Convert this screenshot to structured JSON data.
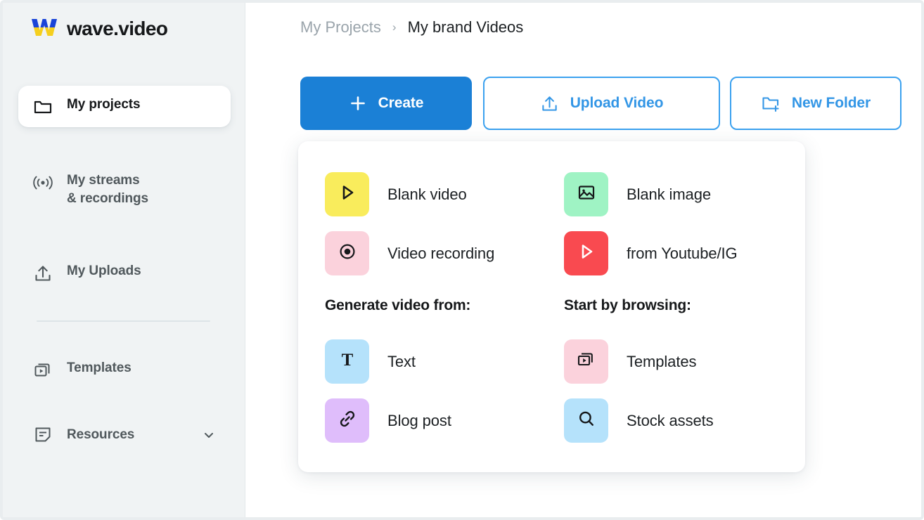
{
  "brand": {
    "name": "wave.video",
    "logo_icon": "wave-w-logo-icon",
    "logo_colors": {
      "top": "#1a44d8",
      "bottom": "#f5cf1e"
    }
  },
  "sidebar": {
    "background": "#f0f3f4",
    "items": [
      {
        "id": "my-projects",
        "label": "My projects",
        "icon": "folder-icon",
        "active": true
      },
      {
        "id": "my-streams",
        "label": "My streams\n& recordings",
        "label_line1": "My streams",
        "label_line2": "& recordings",
        "icon": "broadcast-icon",
        "active": false
      },
      {
        "id": "my-uploads",
        "label": "My Uploads",
        "icon": "upload-icon",
        "active": false
      },
      {
        "id": "templates",
        "label": "Templates",
        "icon": "templates-icon",
        "active": false
      },
      {
        "id": "resources",
        "label": "Resources",
        "icon": "note-icon",
        "chevron": "chevron-down-icon",
        "active": false
      }
    ]
  },
  "breadcrumb": {
    "root": "My Projects",
    "separator": "›",
    "current": "My brand Videos"
  },
  "toolbar": {
    "create_label": "Create",
    "create_icon": "plus-icon",
    "create_bg": "#1b80d6",
    "upload_label": "Upload Video",
    "upload_icon": "upload-icon",
    "new_folder_label": "New Folder",
    "new_folder_icon": "folder-plus-icon",
    "accent": "#3396e6"
  },
  "create_panel": {
    "left_column": {
      "quick": [
        {
          "label": "Blank video",
          "icon": "play-outline-icon",
          "tile_bg": "#f9ec5c",
          "icon_color": "#16181a"
        },
        {
          "label": "Video recording",
          "icon": "record-dot-icon",
          "tile_bg": "#fbd2dc",
          "icon_color": "#16181a"
        }
      ],
      "heading": "Generate video from:",
      "items": [
        {
          "label": "Text",
          "icon": "text-t-icon",
          "tile_bg": "#b5e2fb",
          "icon_color": "#16181a"
        },
        {
          "label": "Blog post",
          "icon": "link-chain-icon",
          "tile_bg": "#dfbdfb",
          "icon_color": "#16181a"
        }
      ]
    },
    "right_column": {
      "quick": [
        {
          "label": "Blank image",
          "icon": "image-icon",
          "tile_bg": "#9ff3c4",
          "icon_color": "#16181a"
        },
        {
          "label": "from Youtube/IG",
          "icon": "play-outline-icon",
          "tile_bg": "#f94a50",
          "icon_color": "#ffffff"
        }
      ],
      "heading": "Start by browsing:",
      "items": [
        {
          "label": "Templates",
          "icon": "templates-icon",
          "tile_bg": "#fbd2dc",
          "icon_color": "#16181a"
        },
        {
          "label": "Stock assets",
          "icon": "search-icon",
          "tile_bg": "#b5e2fb",
          "icon_color": "#16181a"
        }
      ]
    }
  }
}
